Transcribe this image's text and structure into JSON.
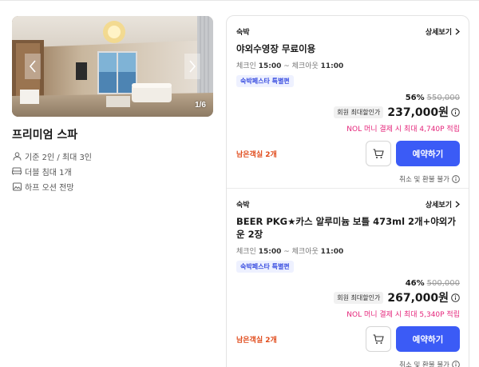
{
  "room": {
    "name": "프리미엄 스파",
    "photo_counter": "1/6",
    "info": [
      {
        "icon": "person-icon",
        "text": "기준 2인 / 최대 3인"
      },
      {
        "icon": "bed-icon",
        "text": "더블 침대 1개"
      },
      {
        "icon": "image-icon",
        "text": "하프 오션 전망"
      }
    ]
  },
  "options": [
    {
      "type": "숙박",
      "detail_label": "상세보기",
      "title": "야외수영장 무료이용",
      "checkin_label": "체크인",
      "checkin_time": "15:00",
      "checkout_label": "~ 체크아웃",
      "checkout_time": "11:00",
      "tag": "숙박페스타 특별편",
      "discount": "56%",
      "original_price": "550,000",
      "member_badge": "회원 최대할인가",
      "final_price": "237,000원",
      "nol_text": "NOL 머니 결제 시 최대 4,740P 적립",
      "rooms_left": "남은객실 2개",
      "reserve_label": "예약하기",
      "cancel_text": "취소 및 환불 불가"
    },
    {
      "type": "숙박",
      "detail_label": "상세보기",
      "title": "BEER PKG★카스 알루미늄 보틀 473ml 2개+야외가운 2장",
      "checkin_label": "체크인",
      "checkin_time": "15:00",
      "checkout_label": "~ 체크아웃",
      "checkout_time": "11:00",
      "tag": "숙박페스타 특별편",
      "discount": "46%",
      "original_price": "500,000",
      "member_badge": "회원 최대할인가",
      "final_price": "267,000원",
      "nol_text": "NOL 머니 결제 시 최대 5,340P 적립",
      "rooms_left": "남은객실 2개",
      "reserve_label": "예약하기",
      "cancel_text": "취소 및 환불 불가"
    }
  ],
  "colors": {
    "accent": "#3b5bf6",
    "pink": "#e5267b",
    "rooms_left": "#e04a1a",
    "tag_bg": "#eef1ff"
  }
}
